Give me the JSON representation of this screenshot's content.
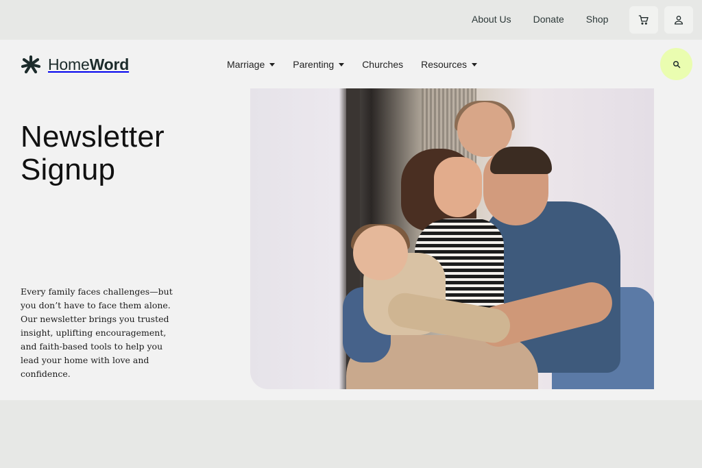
{
  "utility_nav": {
    "links": [
      "About Us",
      "Donate",
      "Shop"
    ],
    "cart_icon": "cart-icon",
    "account_icon": "user-icon"
  },
  "brand": {
    "name_light": "Home",
    "name_bold": "Word",
    "logo_icon": "homeword-burst-logo",
    "accent_color": "#eafdb0",
    "text_color": "#1c2b2b"
  },
  "main_nav": {
    "items": [
      {
        "label": "Marriage",
        "has_dropdown": true
      },
      {
        "label": "Parenting",
        "has_dropdown": true
      },
      {
        "label": "Churches",
        "has_dropdown": false
      },
      {
        "label": "Resources",
        "has_dropdown": true
      }
    ],
    "search_icon": "search-icon"
  },
  "hero": {
    "title_line1": "Newsletter",
    "title_line2": "Signup",
    "intro": "Every family faces challenges—but you don’t have to face them alone. Our newsletter brings you trusted insight, uplifting encouragement, and faith-based tools to help you lead your home with love and confidence."
  }
}
